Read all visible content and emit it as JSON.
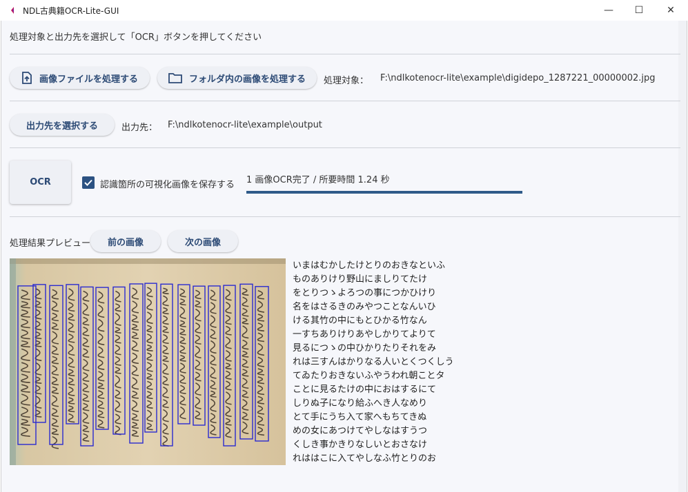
{
  "window": {
    "title": "NDL古典籍OCR-Lite-GUI",
    "minimize_glyph": "—",
    "maximize_glyph": "☐",
    "close_glyph": "✕"
  },
  "instruction": "処理対象と出力先を選択して「OCR」ボタンを押してください",
  "input": {
    "file_button": "画像ファイルを処理する",
    "folder_button": "フォルダ内の画像を処理する",
    "target_label": "処理対象：",
    "target_path": "F:\\ndlkotenocr-lite\\example\\digidepo_1287221_00000002.jpg"
  },
  "output": {
    "select_button": "出力先を選択する",
    "label": "出力先：",
    "path": "F:\\ndlkotenocr-lite\\example\\output"
  },
  "ocr": {
    "button": "OCR",
    "checkbox_label": "認識箇所の可視化画像を保存する",
    "checkbox_checked": true,
    "status": "1 画像OCR完了 / 所要時間 1.24 秒",
    "progress": 1.0
  },
  "preview": {
    "label": "処理結果プレビュー",
    "prev_button": "前の画像",
    "next_button": "次の画像",
    "text_lines": [
      "いまはむかしたけとりのおきなといふ",
      "ものありけり野山にましりてたけ",
      "をとりつゝよろつの事につかひけり",
      "名をはさるきのみやつことなんいひ",
      "ける其竹の中にもとひかる竹なん",
      "一すちありけりあやしかりてよりて",
      "見るにつゝの中ひかりたりそれをみ",
      "れは三すんはかりなる人いとくつくしう",
      "てゐたりおきないふやうわれ朝ことタ",
      "ことに見るたけの中におはするにて",
      "しりぬ子になり給ふへき人なめり",
      "とて手にうち入て家へもちてきぬ",
      "めの女にあつけてやしなはすうつ",
      "くしき事かきりなしいとおさなけ",
      "れははこに入てやしなふ竹とりのお"
    ]
  },
  "colors": {
    "accent": "#2c4a75",
    "progress": "#2f5a89",
    "background": "#f6f7fb",
    "box": "#2a2ad0"
  }
}
